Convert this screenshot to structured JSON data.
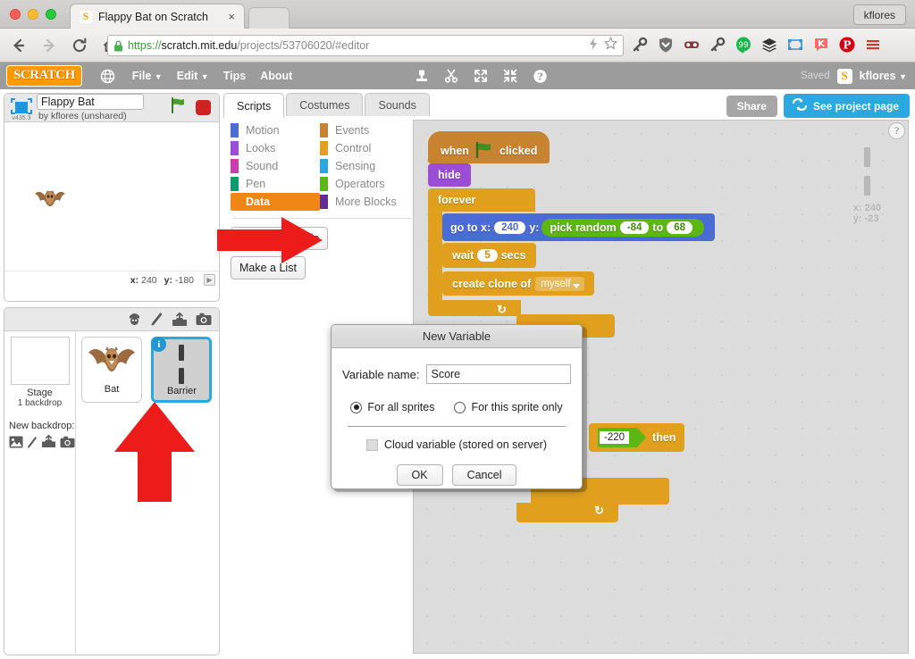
{
  "browser": {
    "tab_title": "Flappy Bat on Scratch",
    "tab_close": "×",
    "favicon_letter": "S",
    "profile_label": "kflores",
    "url_scheme": "https://",
    "url_host": "scratch.mit.edu",
    "url_rest": "/projects/53706020/#editor",
    "nav_back": "back-arrow",
    "nav_forward": "forward-arrow",
    "nav_reload": "reload-icon",
    "nav_home": "home-icon",
    "extensions": [
      "key-icon",
      "shield-icon",
      "mask-icon",
      "key2-icon",
      "hangouts-icon",
      "layers-icon",
      "screenshot-icon",
      "k-icon",
      "pinterest-icon",
      "menu-icon"
    ]
  },
  "scratch_menu": {
    "logo": "SCRATCH",
    "globe": "globe-icon",
    "items": [
      "File",
      "Edit",
      "Tips",
      "About"
    ],
    "tools": [
      "duplicate-stamp-icon",
      "cut-scissors-icon",
      "grow-icon",
      "shrink-icon",
      "help-icon"
    ],
    "saved": "Saved",
    "username": "kflores"
  },
  "stage": {
    "version": "v435.3",
    "project_name": "Flappy Bat",
    "author_line": "by kflores (unshared)",
    "green_flag": "green-flag-icon",
    "stop": "stop-icon",
    "x_label": "x:",
    "x_value": "240",
    "y_label": "y:",
    "y_value": "-180"
  },
  "sprite_pane": {
    "toolbar_icons": [
      "new-sprite-icon",
      "paint-sprite-icon",
      "upload-sprite-icon",
      "camera-sprite-icon"
    ],
    "stage_label": "Stage",
    "stage_sub": "1 backdrop",
    "new_backdrop_label": "New backdrop:",
    "backdrop_icons": [
      "library-icon",
      "paint-icon",
      "upload-icon",
      "camera-icon"
    ],
    "sprites": [
      {
        "name": "Bat",
        "selected": false,
        "badge": ""
      },
      {
        "name": "Barrier",
        "selected": true,
        "badge": "i"
      }
    ]
  },
  "editor": {
    "tabs": [
      {
        "label": "Scripts",
        "active": true
      },
      {
        "label": "Costumes",
        "active": false
      },
      {
        "label": "Sounds",
        "active": false
      }
    ],
    "share_label": "Share",
    "project_page_label": "See project page",
    "project_page_icon": "refresh-arrows-icon",
    "help_icon": "question-icon"
  },
  "palette": {
    "categories_left": [
      {
        "label": "Motion",
        "color": "#4a6cd4",
        "active": false
      },
      {
        "label": "Looks",
        "color": "#9b4dd6",
        "active": false
      },
      {
        "label": "Sound",
        "color": "#cc3bb2",
        "active": false
      },
      {
        "label": "Pen",
        "color": "#0e9a6c",
        "active": false
      },
      {
        "label": "Data",
        "color": "#ef8615",
        "active": true
      }
    ],
    "categories_right": [
      {
        "label": "Events",
        "color": "#c88330",
        "active": false
      },
      {
        "label": "Control",
        "color": "#e0a01e",
        "active": false
      },
      {
        "label": "Sensing",
        "color": "#2ca5e2",
        "active": false
      },
      {
        "label": "Operators",
        "color": "#5cb712",
        "active": false
      },
      {
        "label": "More Blocks",
        "color": "#632d99",
        "active": false
      }
    ],
    "make_variable": "Make a Variable",
    "make_list": "Make a List"
  },
  "canvas": {
    "watermark_x_label": "x:",
    "watermark_x_value": "240",
    "watermark_y_label": "y:",
    "watermark_y_value": "-23"
  },
  "script": {
    "hat_when": "when",
    "hat_clicked": "clicked",
    "hide": "hide",
    "forever": "forever",
    "goto_x": "go to x:",
    "goto_x_val": "240",
    "goto_y": "y:",
    "pick_random": "pick random",
    "pick_from": "-84",
    "pick_to_label": "to",
    "pick_to": "68",
    "wait": "wait",
    "wait_val": "5",
    "secs": "secs",
    "create_clone": "create clone of",
    "clone_target": "myself",
    "if_value": "-220",
    "then": "then"
  },
  "modal": {
    "title": "New Variable",
    "name_label": "Variable name:",
    "name_value": "Score",
    "name_placeholder": "",
    "radio_all": "For all sprites",
    "radio_this": "For this sprite only",
    "cloud_label": "Cloud variable (stored on server)",
    "ok": "OK",
    "cancel": "Cancel"
  },
  "annotations": {
    "arrow_right": "red-arrow-pointing-right",
    "arrow_up": "red-arrow-pointing-up"
  }
}
